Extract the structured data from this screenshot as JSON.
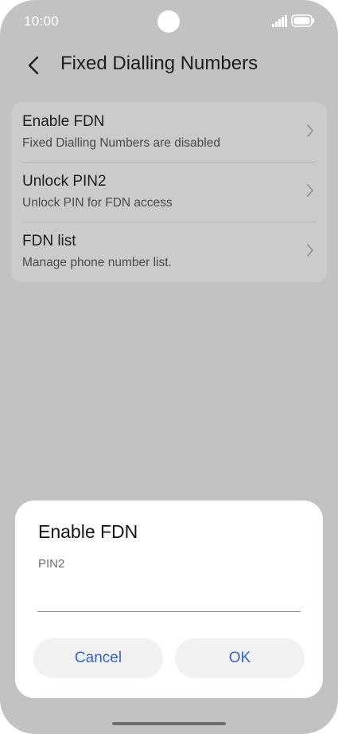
{
  "status_bar": {
    "time": "10:00"
  },
  "header": {
    "title": "Fixed Dialling Numbers"
  },
  "list": {
    "items": [
      {
        "title": "Enable FDN",
        "subtitle": "Fixed Dialling Numbers are disabled"
      },
      {
        "title": "Unlock PIN2",
        "subtitle": "Unlock PIN for FDN access"
      },
      {
        "title": "FDN list",
        "subtitle": "Manage phone number list."
      }
    ]
  },
  "dialog": {
    "title": "Enable FDN",
    "field_label": "PIN2",
    "input_value": "",
    "cancel_label": "Cancel",
    "ok_label": "OK"
  },
  "colors": {
    "background": "#c2c2c5",
    "accent": "#2f64cc",
    "dialog": "#ffffff"
  }
}
